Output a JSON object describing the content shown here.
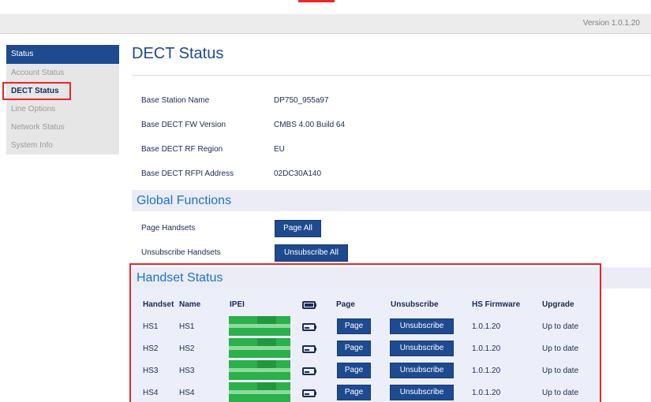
{
  "header": {
    "version": "Version 1.0.1.20"
  },
  "sidebar": {
    "header": "Status",
    "items": [
      {
        "label": "Account Status"
      },
      {
        "label": "DECT Status"
      },
      {
        "label": "Line Options"
      },
      {
        "label": "Network Status"
      },
      {
        "label": "System Info"
      }
    ],
    "active_index": 1
  },
  "page": {
    "title": "DECT Status"
  },
  "base_info": [
    {
      "label": "Base Station Name",
      "value": "DP750_955a97"
    },
    {
      "label": "Base DECT FW Version",
      "value": "CMBS 4.00 Build 64"
    },
    {
      "label": "Base DECT RF Region",
      "value": "EU"
    },
    {
      "label": "Base DECT RFPI Address",
      "value": "02DC30A140"
    }
  ],
  "global_functions": {
    "title": "Global Functions",
    "page_handsets_label": "Page Handsets",
    "page_all_button": "Page All",
    "unsubscribe_handsets_label": "Unsubscribe Handsets",
    "unsubscribe_all_button": "Unsubscribe All"
  },
  "handset_status": {
    "title": "Handset Status",
    "columns": {
      "handset": "Handset",
      "name": "Name",
      "ipei": "IPEI",
      "battery_icon": "battery-icon",
      "page": "Page",
      "unsubscribe": "Unsubscribe",
      "hs_firmware": "HS Firmware",
      "upgrade": "Upgrade"
    },
    "rows": [
      {
        "handset": "HS1",
        "name": "HS1",
        "page_button": "Page",
        "unsubscribe_button": "Unsubscribe",
        "hs_firmware": "1.0.1.20",
        "upgrade": "Up to date"
      },
      {
        "handset": "HS2",
        "name": "HS2",
        "page_button": "Page",
        "unsubscribe_button": "Unsubscribe",
        "hs_firmware": "1.0.1.20",
        "upgrade": "Up to date"
      },
      {
        "handset": "HS3",
        "name": "HS3",
        "page_button": "Page",
        "unsubscribe_button": "Unsubscribe",
        "hs_firmware": "1.0.1.20",
        "upgrade": "Up to date"
      },
      {
        "handset": "HS4",
        "name": "HS4",
        "page_button": "Page",
        "unsubscribe_button": "Unsubscribe",
        "hs_firmware": "1.0.1.20",
        "upgrade": "Up to date"
      }
    ]
  },
  "colors": {
    "brand_blue": "#1e4a8f",
    "link_blue": "#1e73be",
    "highlight_red": "#e8262b",
    "ipei_mask_green": "#2bb04b"
  }
}
